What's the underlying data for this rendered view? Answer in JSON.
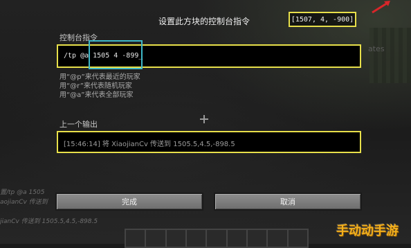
{
  "dialog": {
    "title": "设置此方块的控制台指令",
    "coordinates": "[1507, 4, -900]"
  },
  "command": {
    "label": "控制台指令",
    "value": "/tp @a 1505 4 -899_",
    "help": [
      "用“@p”来代表最近的玩家",
      "用“@r”来代表随机玩家",
      "用“@a”来代表全部玩家"
    ]
  },
  "output": {
    "label": "上一个输出",
    "value": "[15:46:14] 将 XiaojianCv 传送到 1505.5,4.5,-898.5"
  },
  "buttons": {
    "done": "完成",
    "cancel": "取消"
  },
  "background": {
    "chat_lines": [
      "置/tp @a 1505",
      "aojianCv 传送到",
      "jianCv 传送到 1505.5,4.5,-898.5"
    ],
    "side_text": "ates"
  },
  "watermark": "手动动手游",
  "colors": {
    "highlight_yellow": "#e8e04a",
    "highlight_cyan": "#3fb8c8",
    "button_gray": "#7d7d7d",
    "watermark_orange": "#f2b01e"
  }
}
